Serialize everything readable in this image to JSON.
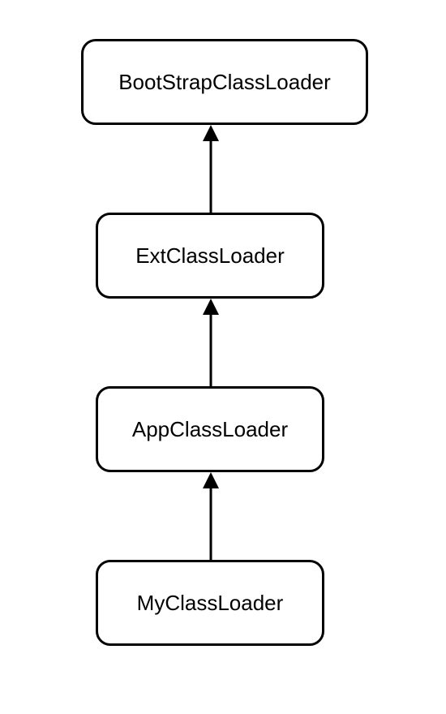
{
  "diagram": {
    "nodes": [
      {
        "id": "bootstrap",
        "label": "BootStrapClassLoader"
      },
      {
        "id": "ext",
        "label": "ExtClassLoader"
      },
      {
        "id": "app",
        "label": "AppClassLoader"
      },
      {
        "id": "my",
        "label": "MyClassLoader"
      }
    ],
    "edges": [
      {
        "from": "ext",
        "to": "bootstrap"
      },
      {
        "from": "app",
        "to": "ext"
      },
      {
        "from": "my",
        "to": "app"
      }
    ]
  }
}
